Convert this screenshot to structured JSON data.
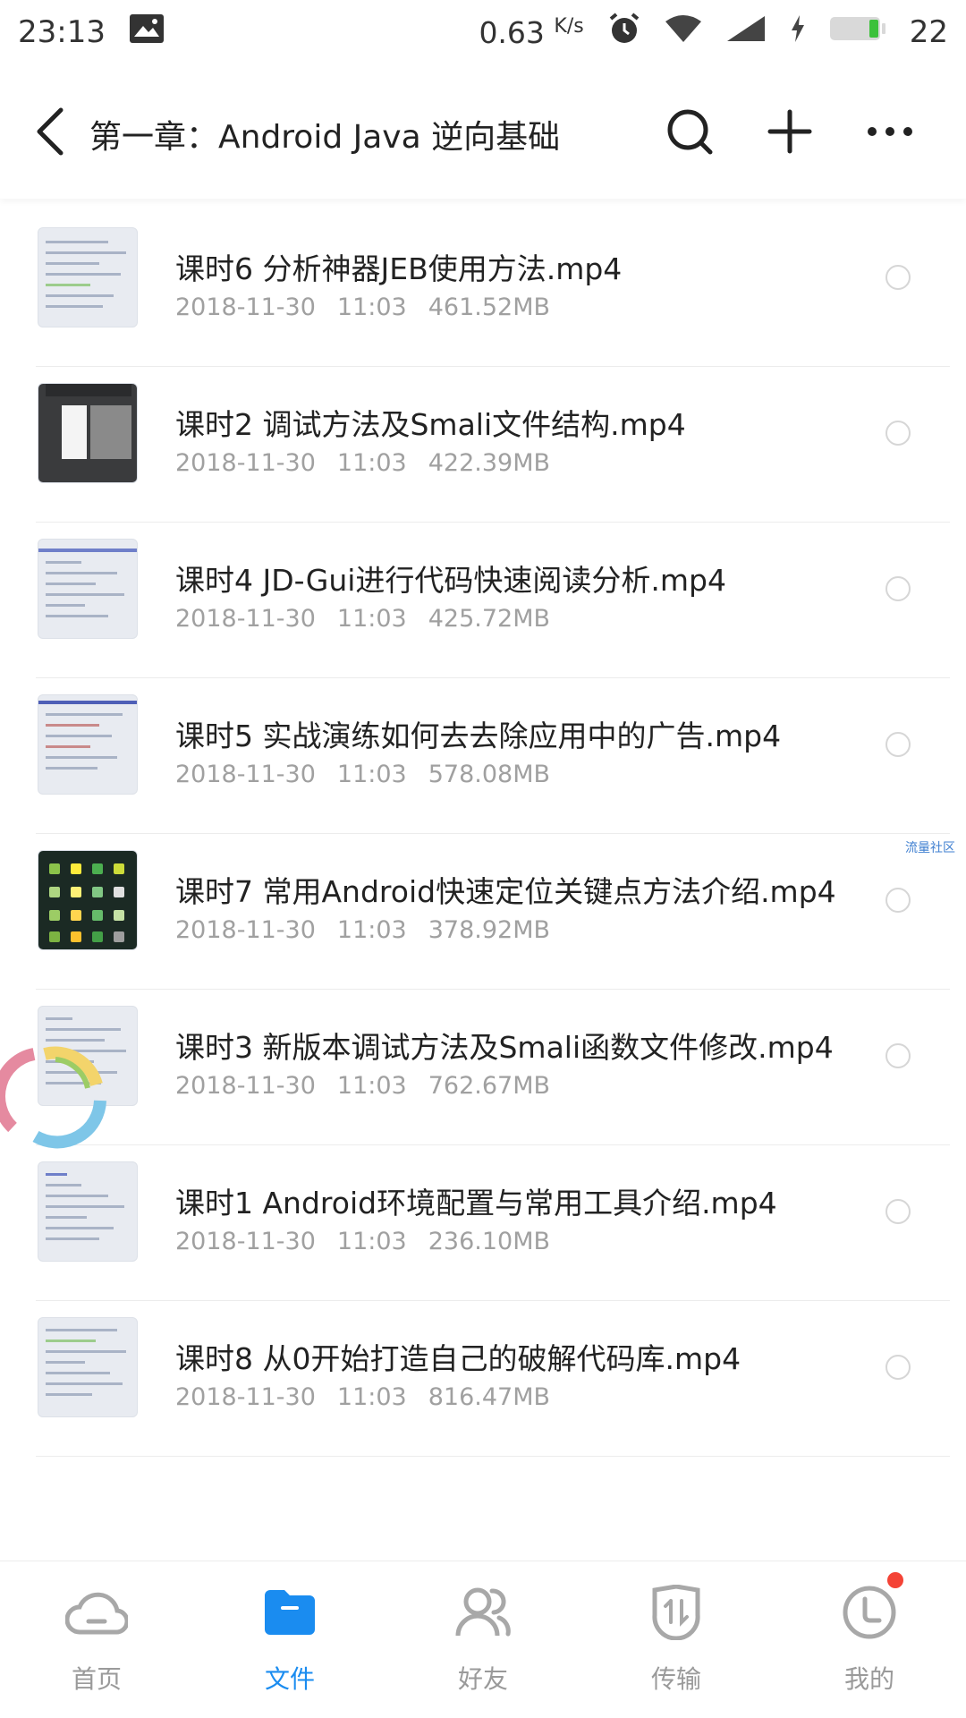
{
  "status_bar": {
    "time": "23:13",
    "net_speed": "0.63",
    "net_unit": "K/s",
    "battery": "22"
  },
  "header": {
    "title": "第一章：Android Java 逆向基础"
  },
  "files": [
    {
      "name": "课时6  分析神器JEB使用方法.mp4",
      "date": "2018-11-30",
      "time": "11:03",
      "size": "461.52MB"
    },
    {
      "name": "课时2 调试方法及Smali文件结构.mp4",
      "date": "2018-11-30",
      "time": "11:03",
      "size": "422.39MB"
    },
    {
      "name": "课时4 JD-Gui进行代码快速阅读分析.mp4",
      "date": "2018-11-30",
      "time": "11:03",
      "size": "425.72MB"
    },
    {
      "name": "课时5 实战演练如何去去除应用中的广告.mp4",
      "date": "2018-11-30",
      "time": "11:03",
      "size": "578.08MB"
    },
    {
      "name": "课时7 常用Android快速定位关键点方法介绍.mp4",
      "date": "2018-11-30",
      "time": "11:03",
      "size": "378.92MB"
    },
    {
      "name": "课时3 新版本调试方法及Smali函数文件修改.mp4",
      "date": "2018-11-30",
      "time": "11:03",
      "size": "762.67MB"
    },
    {
      "name": "课时1  Android环境配置与常用工具介绍.mp4",
      "date": "2018-11-30",
      "time": "11:03",
      "size": "236.10MB"
    },
    {
      "name": "课时8 从0开始打造自己的破解代码库.mp4",
      "date": "2018-11-30",
      "time": "11:03",
      "size": "816.47MB"
    }
  ],
  "watermark": "流量社区",
  "bottom_nav": [
    {
      "label": "首页",
      "icon": "cloud-icon"
    },
    {
      "label": "文件",
      "icon": "folder-icon"
    },
    {
      "label": "好友",
      "icon": "friends-icon"
    },
    {
      "label": "传输",
      "icon": "transfer-icon"
    },
    {
      "label": "我的",
      "icon": "profile-icon"
    }
  ],
  "colors": {
    "accent": "#1a8cf0",
    "badge": "#f44336"
  }
}
